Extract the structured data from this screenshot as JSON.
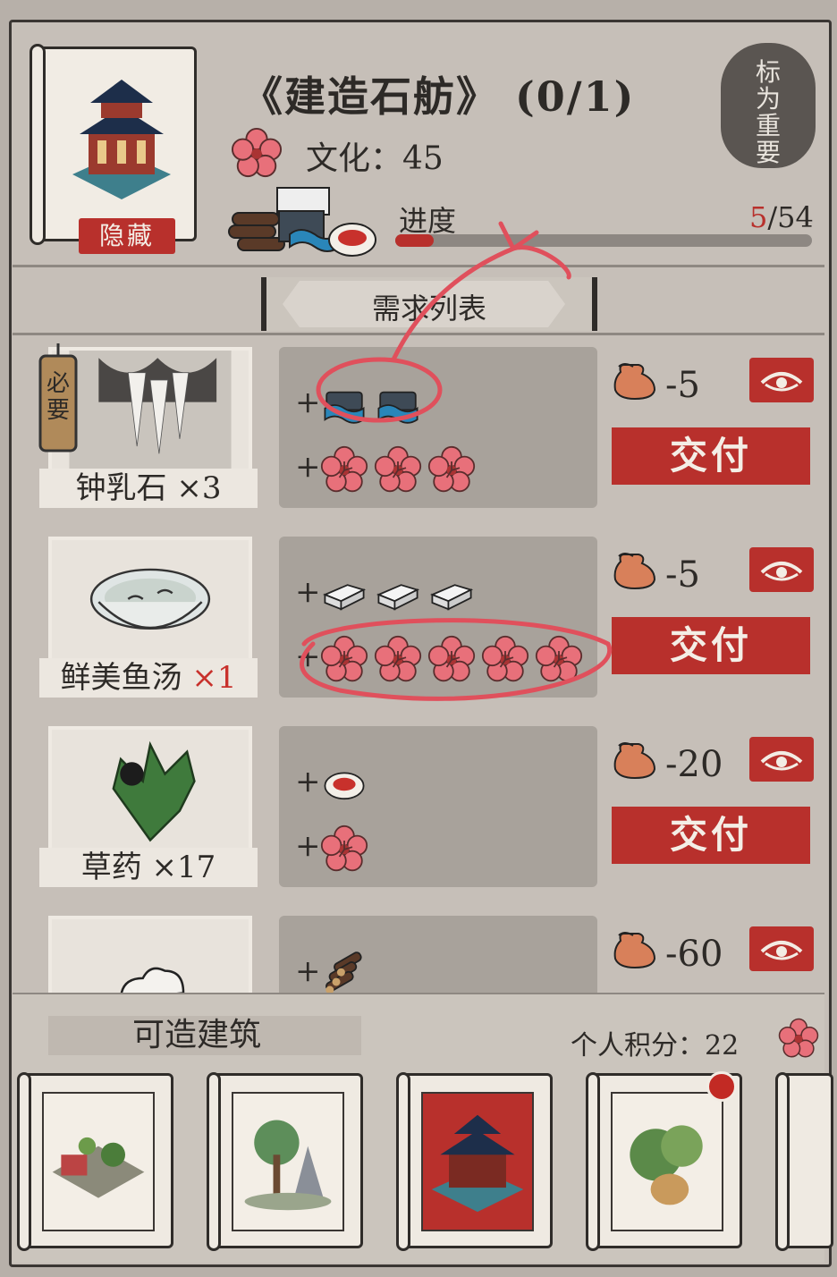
{
  "header": {
    "title": "《建造石舫》 (0/1)",
    "hidden_label": "隐藏",
    "culture_label": "文化：",
    "culture_value": "45",
    "progress_label": "进度",
    "progress_current": "5",
    "progress_total": "/54",
    "progress_fraction": 0.093,
    "important_label": "标为重要"
  },
  "requirements": {
    "section_title": "需求列表",
    "required_tag": "必要",
    "items": [
      {
        "name": "钟乳石 ",
        "count": "×3",
        "cost_lines": [
          [
            "cloth-icon",
            "cloth-icon"
          ],
          [
            "flower-icon",
            "flower-icon",
            "flower-icon"
          ]
        ],
        "bag_value": "-5",
        "pay_label": "交付"
      },
      {
        "name": "鲜美鱼汤 ",
        "count": "×1",
        "cost_lines": [
          [
            "stone-icon",
            "stone-icon",
            "stone-icon"
          ],
          [
            "flower-icon",
            "flower-icon",
            "flower-icon",
            "flower-icon",
            "flower-icon"
          ]
        ],
        "bag_value": "-5",
        "pay_label": "交付"
      },
      {
        "name": "草药 ",
        "count": "×17",
        "cost_lines": [
          [
            "bowl-icon"
          ],
          [
            "flower-icon"
          ]
        ],
        "bag_value": "-20",
        "pay_label": "交付"
      },
      {
        "name": "",
        "count": "",
        "cost_lines": [
          [
            "wood-icon"
          ]
        ],
        "bag_value": "-60",
        "pay_label": ""
      }
    ]
  },
  "footer": {
    "buildable_label": "可造建筑",
    "score_label": "个人积分：",
    "score_value": "22"
  },
  "colors": {
    "accent_red": "#b8302c",
    "panel": "#c6bfb8",
    "flower": "#e8707a"
  }
}
